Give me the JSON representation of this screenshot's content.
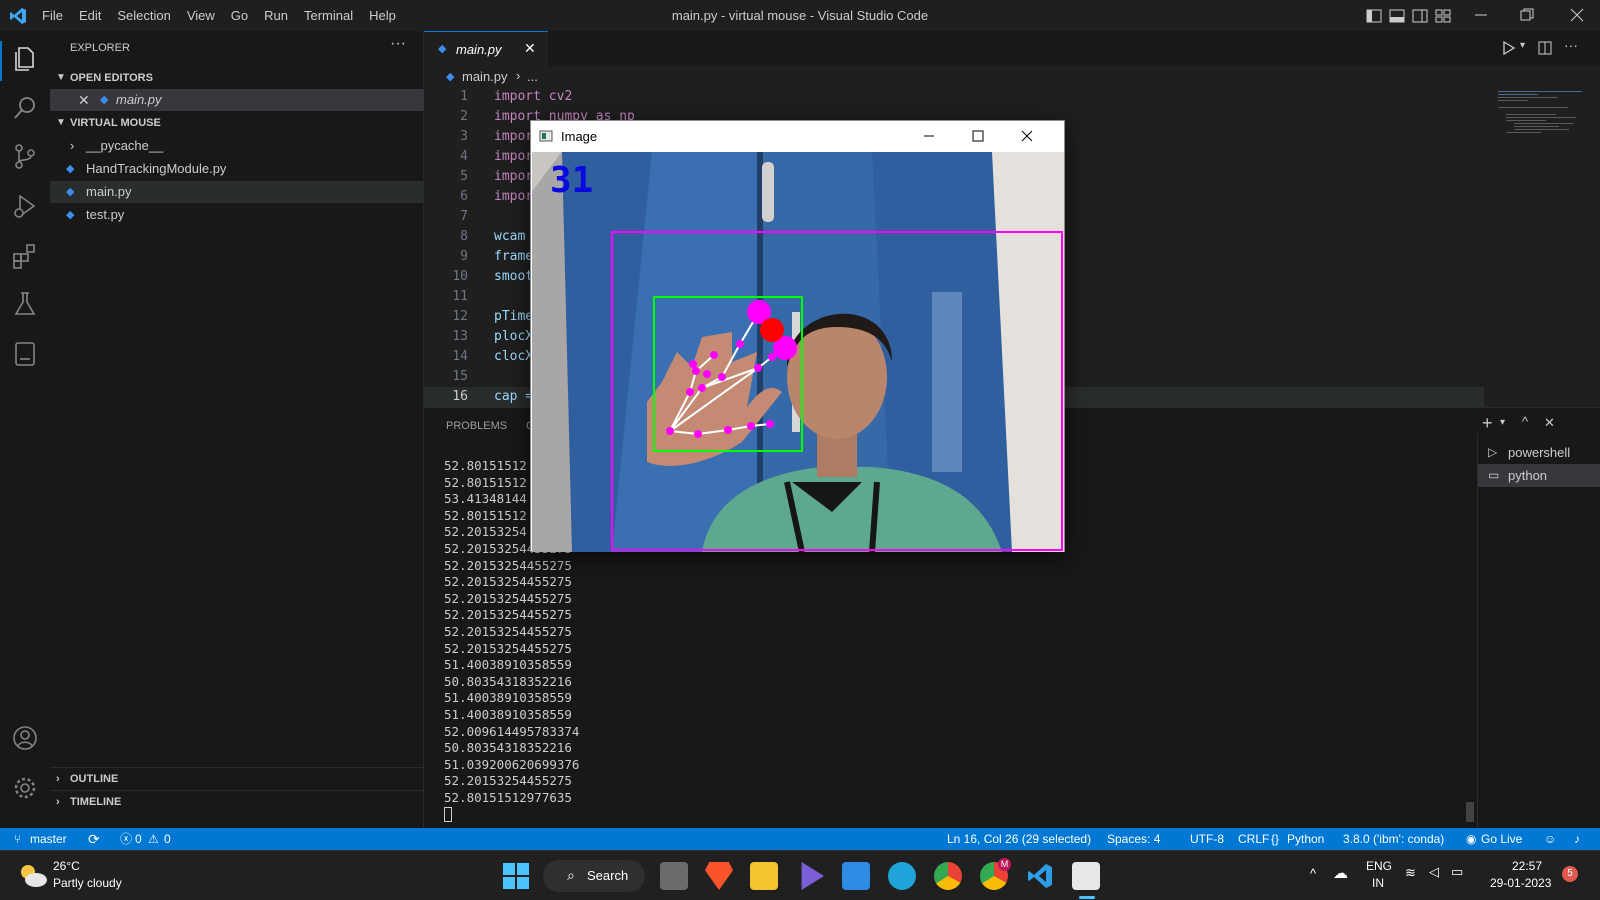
{
  "titlebar": {
    "menu": [
      "File",
      "Edit",
      "Selection",
      "View",
      "Go",
      "Run",
      "Terminal",
      "Help"
    ],
    "title": "main.py - virtual mouse - Visual Studio Code"
  },
  "sidebar": {
    "explorer_title": "EXPLORER",
    "open_editors": "OPEN EDITORS",
    "open_file": "main.py",
    "folder": "VIRTUAL MOUSE",
    "items": [
      "__pycache__",
      "HandTrackingModule.py",
      "main.py",
      "test.py"
    ],
    "outline": "OUTLINE",
    "timeline": "TIMELINE"
  },
  "editor": {
    "tab": "main.py",
    "breadcrumb_file": "main.py",
    "breadcrumb_rest": "...",
    "lines": [
      {
        "n": "1",
        "text": "import cv2"
      },
      {
        "n": "2",
        "text": "import numpy as np"
      },
      {
        "n": "3",
        "text": "impor"
      },
      {
        "n": "4",
        "text": "impor"
      },
      {
        "n": "5",
        "text": "impor"
      },
      {
        "n": "6",
        "text": "impor"
      },
      {
        "n": "7",
        "text": ""
      },
      {
        "n": "8",
        "text": "wcam"
      },
      {
        "n": "9",
        "text": "frame"
      },
      {
        "n": "10",
        "text": "smoot"
      },
      {
        "n": "11",
        "text": ""
      },
      {
        "n": "12",
        "text": "pTime"
      },
      {
        "n": "13",
        "text": "plocX"
      },
      {
        "n": "14",
        "text": "clocX"
      },
      {
        "n": "15",
        "text": ""
      },
      {
        "n": "16",
        "text": "cap ="
      }
    ]
  },
  "panel": {
    "tab_problems": "PROBLEMS",
    "tab_partial": "C",
    "terminals": [
      "powershell",
      "python"
    ],
    "output": [
      "52.80151512",
      "52.80151512",
      "53.41348144",
      "52.80151512",
      "52.20153254",
      "52.20153254455275",
      "52.20153254455275",
      "52.20153254455275",
      "52.20153254455275",
      "52.20153254455275",
      "52.20153254455275",
      "52.20153254455275",
      "51.40038910358559",
      "50.80354318352216",
      "51.40038910358559",
      "51.40038910358559",
      "52.009614495783374",
      "50.80354318352216",
      "51.039200620699376",
      "52.20153254455275",
      "52.80151512977635"
    ]
  },
  "image_window": {
    "title": "Image",
    "fps": "31"
  },
  "statusbar": {
    "branch": "master",
    "errors": "0",
    "warnings": "0",
    "position": "Ln 16, Col 26 (29 selected)",
    "spaces": "Spaces: 4",
    "encoding": "UTF-8",
    "eol": "CRLF",
    "language": "Python",
    "interpreter": "3.8.0 ('ibm': conda)",
    "golive": "Go Live"
  },
  "taskbar": {
    "weather_temp": "26°C",
    "weather_desc": "Partly cloudy",
    "search": "Search",
    "lang1": "ENG",
    "lang2": "IN",
    "time": "22:57",
    "date": "29-01-2023",
    "notifications": "5",
    "chrome_badge": "M"
  },
  "colors": {
    "accent": "#0078d4",
    "magenta": "#ff00ff",
    "green": "#00ff00"
  }
}
